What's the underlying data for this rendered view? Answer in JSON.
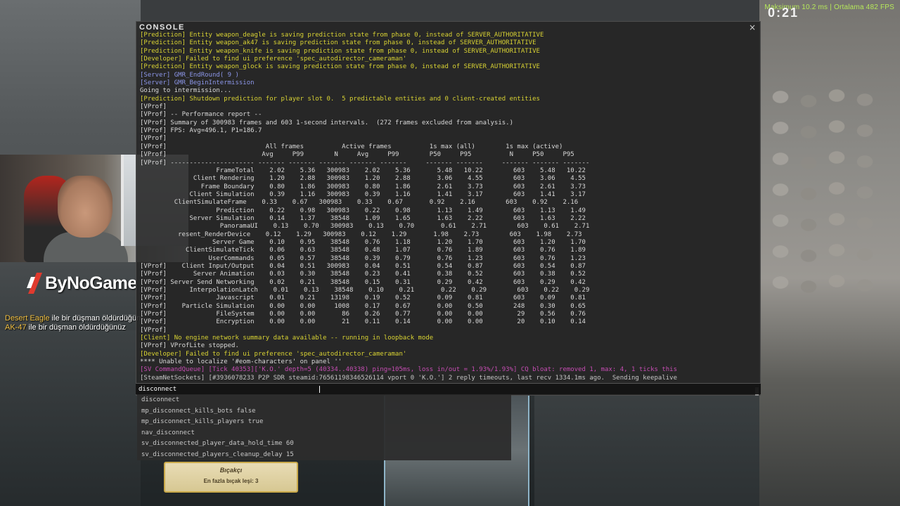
{
  "hud": {
    "fps_text": "Maksimum 10.2 ms | Ortalama 482 FPS",
    "timer": "0:21"
  },
  "stream_overlay": {
    "logo_text": "ByNoGame"
  },
  "killfeed": [
    {
      "weapon": "Desert Eagle",
      "text": " ile bir düşman öldürdüğünüz"
    },
    {
      "weapon": "AK-47",
      "text": " ile bir düşman öldürdüğünüz"
    }
  ],
  "console": {
    "title": "CONSOLE",
    "close_glyph": "×",
    "lines": [
      {
        "cls": "c-pred",
        "text": "[Prediction] Entity weapon_deagle is saving prediction state from phase 0, instead of SERVER_AUTHORITATIVE"
      },
      {
        "cls": "c-pred",
        "text": "[Prediction] Entity weapon_ak47 is saving prediction state from phase 0, instead of SERVER_AUTHORITATIVE"
      },
      {
        "cls": "c-pred",
        "text": "[Prediction] Entity weapon_knife is saving prediction state from phase 0, instead of SERVER_AUTHORITATIVE"
      },
      {
        "cls": "c-dev",
        "text": "[Developer] Failed to find ui preference 'spec_autodirector_cameraman'"
      },
      {
        "cls": "c-pred",
        "text": "[Prediction] Entity weapon_glock is saving prediction state from phase 0, instead of SERVER_AUTHORITATIVE"
      },
      {
        "cls": "c-server",
        "text": "[Server] GMR_EndRound( 9 )"
      },
      {
        "cls": "c-server",
        "text": "[Server] GMR_BeginIntermission"
      },
      {
        "cls": "c-plain",
        "text": "Going to intermission..."
      },
      {
        "cls": "c-pred",
        "text": "[Prediction] Shutdown prediction for player slot 0.  5 predictable entities and 0 client-created entities"
      },
      {
        "cls": "c-vprof",
        "text": "[VProf]"
      },
      {
        "cls": "c-vprof",
        "text": "[VProf] -- Performance report --"
      },
      {
        "cls": "c-vprof",
        "text": "[VProf] Summary of 300983 frames and 603 1-second intervals.  (272 frames excluded from analysis.)"
      },
      {
        "cls": "c-vprof",
        "text": "[VProf] FPS: Avg=496.1, P1=186.7"
      },
      {
        "cls": "c-vprof",
        "text": "[VProf]"
      },
      {
        "cls": "c-vprof",
        "text": "[VProf]                          All frames          Active frames          1s max (all)        1s max (active)"
      },
      {
        "cls": "c-vprof",
        "text": "[VProf]                         Avg     P99        N     Avg     P99        P50     P95          N     P50     P95"
      },
      {
        "cls": "c-vprof",
        "text": "[VProf] ---------------------- ------- ------- ------- ------- -------     ------- -------     ------- ------- -------"
      },
      {
        "cls": "c-vprof",
        "text": "                    FrameTotal    2.02    5.36   300983    2.02    5.36       5.48   10.22        603    5.48   10.22"
      },
      {
        "cls": "c-vprof",
        "text": "              Client Rendering    1.20    2.88   300983    1.20    2.88       3.06    4.55        603    3.06    4.55"
      },
      {
        "cls": "c-vprof",
        "text": "                Frame Boundary    0.80    1.86   300983    0.80    1.86       2.61    3.73        603    2.61    3.73"
      },
      {
        "cls": "c-vprof",
        "text": "             Client Simulation    0.39    1.16   300983    0.39    1.16       1.41    3.17        603    1.41    3.17"
      },
      {
        "cls": "c-vprof",
        "text": "         ClientSimulateFrame    0.33    0.67   300983    0.33    0.67       0.92    2.16        603    0.92    2.16"
      },
      {
        "cls": "c-vprof",
        "text": "                    Prediction    0.22    0.98   300983    0.22    0.98       1.13    1.49        603    1.13    1.49"
      },
      {
        "cls": "c-vprof",
        "text": "             Server Simulation    0.14    1.37    38548    1.09    1.65       1.63    2.22        603    1.63    2.22"
      },
      {
        "cls": "c-vprof",
        "text": "                     PanoramaUI    0.13    0.70   300983    0.13    0.70       0.61    2.71        603    0.61    2.71"
      },
      {
        "cls": "c-vprof",
        "text": "          resent_RenderDevice    0.12    1.29   300983    0.12    1.29       1.98    2.73        603    1.98    2.73"
      },
      {
        "cls": "c-vprof",
        "text": "                   Server Game    0.10    0.95    38548    0.76    1.18       1.20    1.70        603    1.20    1.70"
      },
      {
        "cls": "c-vprof",
        "text": "            ClientSimulateTick    0.06    0.63    38548    0.48    1.07       0.76    1.89        603    0.76    1.89"
      },
      {
        "cls": "c-vprof",
        "text": "                  UserCommands    0.05    0.57    38548    0.39    0.79       0.76    1.23        603    0.76    1.23"
      },
      {
        "cls": "c-vprof",
        "text": "[VProf]    Client Input/Output    0.04    0.51   300983    0.04    0.51       0.54    0.87        603    0.54    0.87"
      },
      {
        "cls": "c-vprof",
        "text": "[VProf]       Server Animation    0.03    0.30    38548    0.23    0.41       0.38    0.52        603    0.38    0.52"
      },
      {
        "cls": "c-vprof",
        "text": "[VProf] Server Send Networking    0.02    0.21    38548    0.15    0.31       0.29    0.42        603    0.29    0.42"
      },
      {
        "cls": "c-vprof",
        "text": "[VProf]      InterpolationLatch    0.01    0.13    38548    0.10    0.21       0.22    0.29        603    0.22    0.29"
      },
      {
        "cls": "c-vprof",
        "text": "[VProf]             Javascript    0.01    0.21    13198    0.19    0.52       0.09    0.81        603    0.09    0.81"
      },
      {
        "cls": "c-vprof",
        "text": "[VProf]    Particle Simulation    0.00    0.00     1008    0.17    0.67       0.00    0.50        248    0.30    0.65"
      },
      {
        "cls": "c-vprof",
        "text": "[VProf]             FileSystem    0.00    0.00       86    0.26    0.77       0.00    0.00         29    0.56    0.76"
      },
      {
        "cls": "c-vprof",
        "text": "[VProf]             Encryption    0.00    0.00       21    0.11    0.14       0.00    0.00         20    0.10    0.14"
      },
      {
        "cls": "c-vprof",
        "text": "[VProf]"
      },
      {
        "cls": "c-client",
        "text": "[Client] No engine network summary data available -- running in loopback mode"
      },
      {
        "cls": "c-plain",
        "text": "[VProf] VProfLite stopped."
      },
      {
        "cls": "c-dev",
        "text": "[Developer] Failed to find ui preference 'spec_autodirector_cameraman'"
      },
      {
        "cls": "c-plain",
        "text": "**** Unable to localize '#eom-characters' on panel ''"
      },
      {
        "cls": "c-err",
        "text": "[SV CommandQueue] [Tick 40353]['K.O.' depth=5 (40334..40338) ping=105ms, loss in/out = 1.93%/1.93%] CQ bloat: removed 1, max: 4, 1 ticks this"
      },
      {
        "cls": "c-sock",
        "text": "[SteamNetSockets] [#3936078233 P2P SDR steamid:76561198346526114 vport 0 'K.O.'] 2 reply timeouts, last recv 1334.1ms ago.  Sending keepalive"
      }
    ],
    "input_value": "disconnect",
    "autocomplete": [
      "disconnect",
      "mp_disconnect_kills_bots false",
      "mp_disconnect_kills_players true",
      "nav_disconnect",
      "sv_disconnected_player_data_hold_time 60",
      "sv_disconnected_players_cleanup_delay 15"
    ]
  },
  "knife_card": {
    "title": "Bıçakçı",
    "subtitle": "En fazla bıçak leşi: 3"
  }
}
